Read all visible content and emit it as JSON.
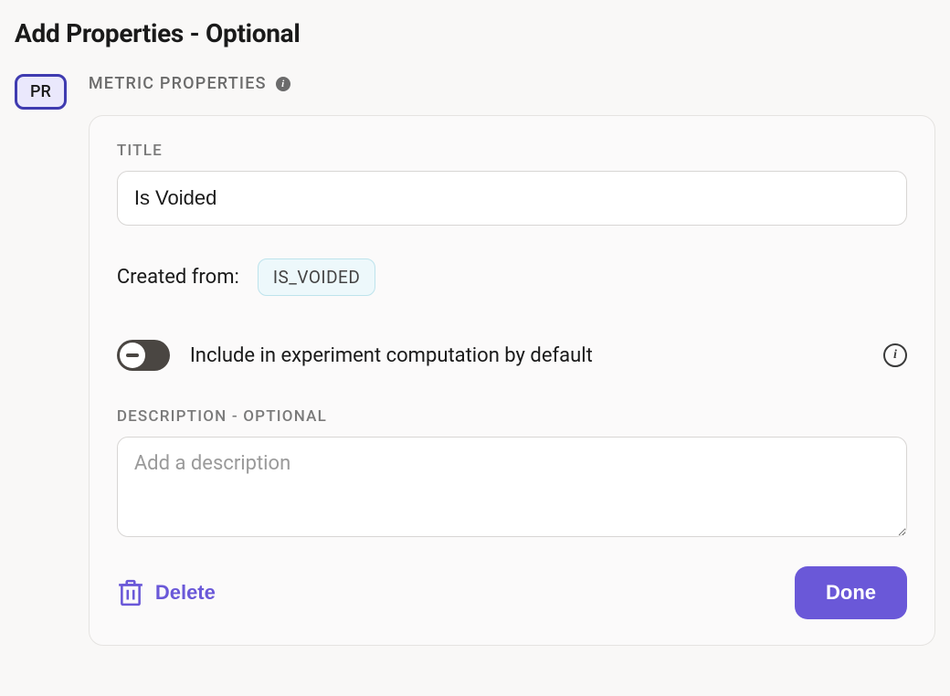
{
  "header": {
    "title": "Add Properties - Optional"
  },
  "chip": {
    "label": "PR"
  },
  "section": {
    "heading": "METRIC PROPERTIES"
  },
  "title_field": {
    "label": "TITLE",
    "value": "Is Voided"
  },
  "created_from": {
    "label": "Created from:",
    "source": "IS_VOIDED"
  },
  "toggle": {
    "label": "Include in experiment computation by default",
    "state": "off"
  },
  "description_field": {
    "label": "DESCRIPTION - OPTIONAL",
    "placeholder": "Add a description",
    "value": ""
  },
  "actions": {
    "delete": "Delete",
    "done": "Done"
  }
}
